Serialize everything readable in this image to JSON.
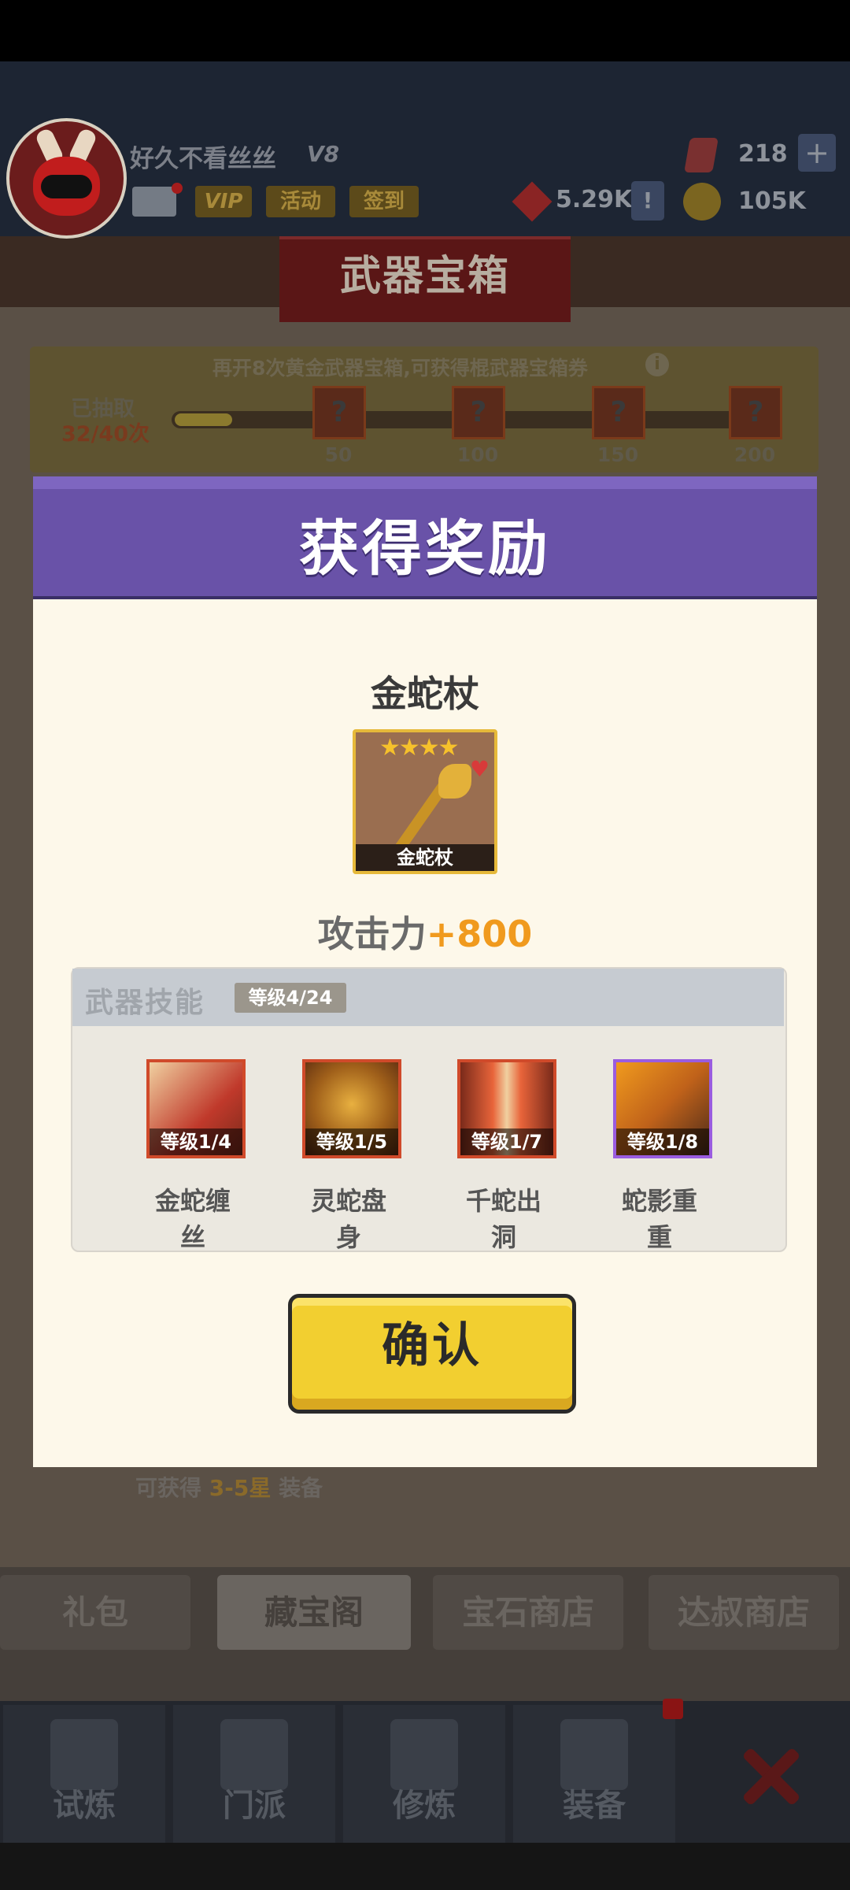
{
  "player": {
    "name": "好久不看丝丝",
    "vip_level": "V8",
    "tags": [
      "VIP",
      "活动",
      "签到"
    ],
    "power": "5.29K",
    "power_btn": "!",
    "gems": "218",
    "gems_plus": "+",
    "coins": "105K"
  },
  "screen_title": "武器宝箱",
  "progress": {
    "hint": "再开8次黄金武器宝箱,可获得棍武器宝箱券",
    "info_icon": "i",
    "drawn_label": "已抽取",
    "drawn_count": "32/40次",
    "fill_fraction": 0.1,
    "milestones": [
      {
        "number": "50",
        "icon": "?"
      },
      {
        "number": "100",
        "icon": "?"
      },
      {
        "number": "150",
        "icon": "?"
      },
      {
        "number": "200",
        "icon": "?"
      }
    ]
  },
  "bg_equip": {
    "prefix": "可获得",
    "highlight": "3-5星",
    "suffix": "装备"
  },
  "shop_tabs": [
    {
      "label": "礼包"
    },
    {
      "label": "藏宝阁"
    },
    {
      "label": "宝石商店"
    },
    {
      "label": "达叔商店"
    }
  ],
  "bottom_nav": [
    {
      "label": "试炼"
    },
    {
      "label": "门派"
    },
    {
      "label": "修炼"
    },
    {
      "label": "装备"
    }
  ],
  "modal": {
    "title": "获得奖励",
    "item_name": "金蛇杖",
    "item_stars": "★★★★",
    "item_heart": "♥",
    "item_caption": "金蛇杖",
    "attack_label": "攻击力",
    "attack_value": "+800",
    "skills_title": "武器技能",
    "skills_level": "等级4/24",
    "skills": [
      {
        "level": "等级1/4",
        "name_line1": "金蛇缠",
        "name_line2": "丝"
      },
      {
        "level": "等级1/5",
        "name_line1": "灵蛇盘",
        "name_line2": "身"
      },
      {
        "level": "等级1/7",
        "name_line1": "千蛇出",
        "name_line2": "洞"
      },
      {
        "level": "等级1/8",
        "name_line1": "蛇影重",
        "name_line2": "重"
      }
    ],
    "confirm_label": "确认"
  },
  "colors": {
    "modal_header": "#6952a8",
    "confirm_button": "#f2cf30",
    "attack_value": "#f09a1e"
  }
}
